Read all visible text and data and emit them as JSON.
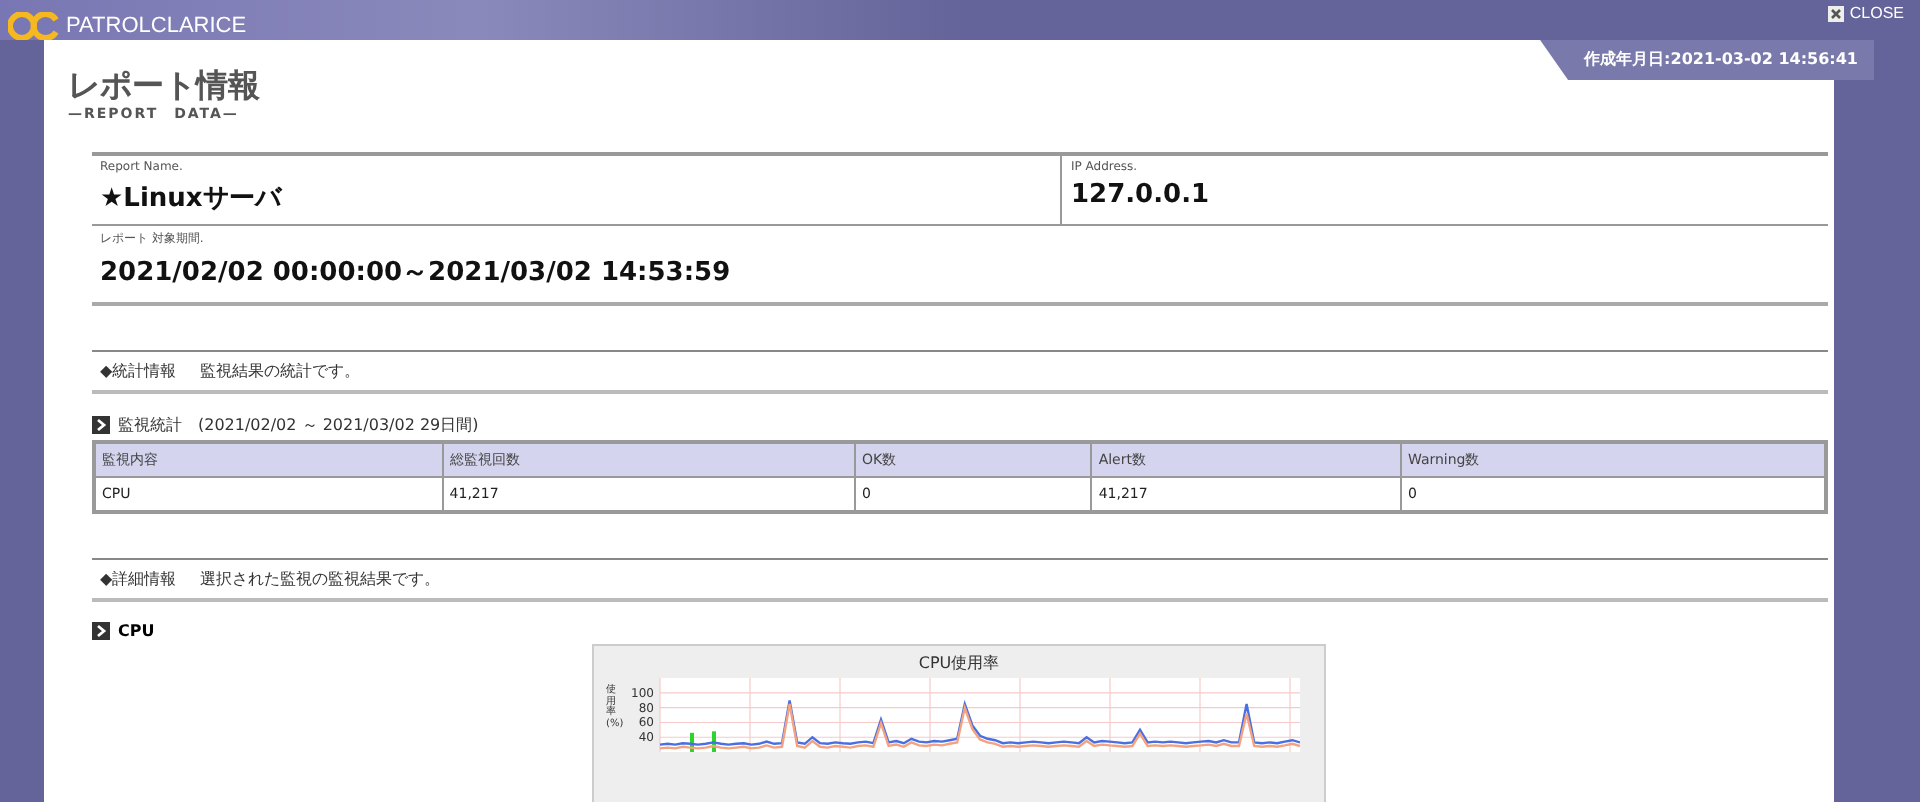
{
  "header": {
    "logo_text": "PATROLCLARICE",
    "close_label": "CLOSE"
  },
  "created": "作成年月日:2021-03-02 14:56:41",
  "page_title": {
    "title": "レポート情報",
    "subtitle": "—REPORT　DATA—"
  },
  "report": {
    "name_label": "Report Name.",
    "name": "★Linuxサーバ",
    "ip_label": "IP Address.",
    "ip": "127.0.0.1",
    "period_label": "レポート 対象期間.",
    "period": "2021/02/02 00:00:00～2021/03/02 14:53:59"
  },
  "stats_section": {
    "marker": "◆",
    "title": "統計情報",
    "description": "監視結果の統計です。"
  },
  "stats_table": {
    "title": "監視統計　(2021/02/02 ～ 2021/03/02  29日間)",
    "columns": [
      "監視内容",
      "総監視回数",
      "OK数",
      "Alert数",
      "Warning数"
    ],
    "rows": [
      [
        "CPU",
        "41,217",
        "0",
        "41,217",
        "0"
      ]
    ]
  },
  "detail_section": {
    "marker": "◆",
    "title": "詳細情報",
    "description": "選択された監視の監視結果です。"
  },
  "cpu_heading": "CPU",
  "chart_data": {
    "type": "line",
    "title": "CPU使用率",
    "ylabel": "使用率(%)",
    "ylim": [
      20,
      104
    ],
    "grid": true,
    "yticks": [
      100,
      80,
      60,
      40
    ],
    "series": [
      {
        "color": "#4a6fe0",
        "values": [
          30,
          31,
          30,
          32,
          31,
          30,
          31,
          33,
          31,
          30,
          31,
          32,
          30,
          31,
          34,
          31,
          32,
          90,
          33,
          31,
          40,
          32,
          31,
          33,
          32,
          31,
          33,
          34,
          32,
          64,
          33,
          35,
          32,
          38,
          34,
          33,
          35,
          34,
          36,
          38,
          85,
          56,
          42,
          38,
          36,
          32,
          33,
          32,
          33,
          34,
          33,
          32,
          33,
          34,
          33,
          32,
          40,
          33,
          35,
          34,
          33,
          32,
          33,
          50,
          33,
          34,
          33,
          34,
          33,
          32,
          33,
          34,
          35,
          33,
          36,
          33,
          33,
          85,
          33,
          32,
          33,
          32,
          34,
          36,
          33
        ]
      },
      {
        "color": "#f3a282",
        "values": [
          25,
          26,
          25,
          27,
          26,
          25,
          26,
          28,
          26,
          25,
          26,
          27,
          25,
          26,
          29,
          26,
          27,
          85,
          28,
          26,
          35,
          27,
          26,
          28,
          27,
          26,
          28,
          29,
          27,
          59,
          28,
          30,
          27,
          33,
          29,
          28,
          30,
          29,
          31,
          33,
          80,
          51,
          37,
          33,
          31,
          27,
          28,
          27,
          28,
          29,
          28,
          27,
          28,
          29,
          28,
          27,
          35,
          28,
          30,
          29,
          28,
          27,
          28,
          45,
          28,
          29,
          28,
          29,
          28,
          27,
          28,
          29,
          30,
          28,
          31,
          28,
          28,
          72,
          28,
          27,
          28,
          27,
          29,
          31,
          28
        ]
      }
    ]
  }
}
